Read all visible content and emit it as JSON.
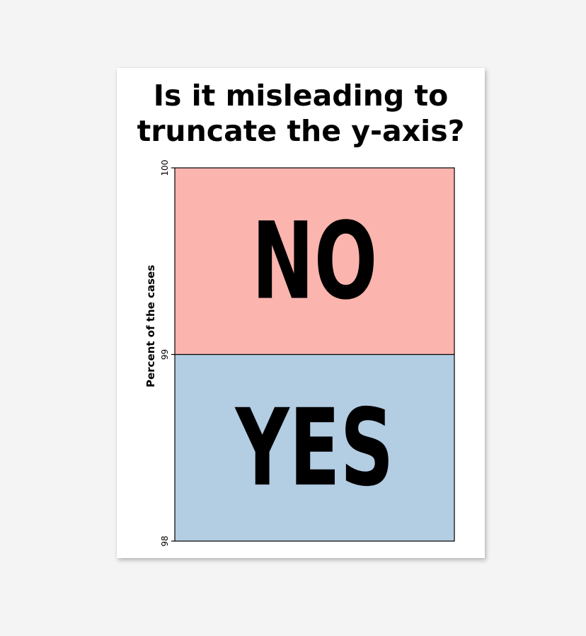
{
  "canvas": {
    "title_lines": [
      "Is it misleading to",
      "truncate the y-axis?"
    ]
  },
  "chart_data": {
    "type": "bar",
    "stacked": true,
    "title": "Is it misleading to truncate the y-axis?",
    "xlabel": "",
    "ylabel": "Percent of the cases",
    "ylim": [
      98,
      100
    ],
    "yticks": [
      "98",
      "99",
      "100"
    ],
    "grid": false,
    "legend": "none",
    "series": [
      {
        "label": "YES",
        "y_from": 98,
        "y_to": 99,
        "color": "#b3cde3"
      },
      {
        "label": "NO",
        "y_from": 99,
        "y_to": 100,
        "color": "#fbb4ae"
      }
    ]
  }
}
